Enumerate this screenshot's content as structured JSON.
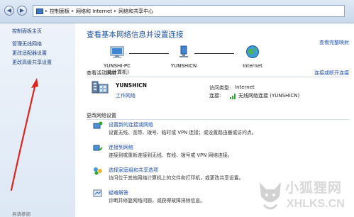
{
  "addressbar": {
    "crumbs": [
      "控制面板",
      "网络和 Internet",
      "网络和共享中心"
    ]
  },
  "sidebar": {
    "items": [
      {
        "label": "控制面板主页"
      },
      {
        "label": "管理无线网络"
      },
      {
        "label": "更改适配器设置"
      },
      {
        "label": "更改高级共享设置"
      }
    ],
    "see_also": "另请参阅"
  },
  "main": {
    "title": "查看基本网络信息并设置连接",
    "full_map": "查看完整映射",
    "map": {
      "pc_name": "YUNSHI-PC",
      "pc_sub": "(此计算机)",
      "network": "YUNSHICN",
      "internet": "Internet"
    },
    "active_header": "查看活动网络",
    "connect_disconnect": "连接或断开连接",
    "active": {
      "name": "YUNSHICN",
      "type": "工作网络",
      "access_label": "访问类型:",
      "access_value": "Internet",
      "conn_label": "连接:",
      "conn_value": "无线网络连接 (YUNSHICN)"
    },
    "change_header": "更改网络设置",
    "tasks": [
      {
        "link": "设置新的连接或网络",
        "desc": "设置无线、宽带、拨号、临时或 VPN 连接；或设置路由器或访问点。"
      },
      {
        "link": "连接到网络",
        "desc": "连接到或重新连接到无线、有线、拨号或 VPN 网络连接。"
      },
      {
        "link": "选择家庭组和共享选项",
        "desc": "访问位于其他网络计算机上的文件和打印机，或更改共享设置。"
      },
      {
        "link": "疑难解答",
        "desc": "诊断并修复网络问题，或获得故障排除信息。"
      }
    ]
  },
  "watermark": {
    "title": "小狐狸网",
    "url": "XHLKS.CN"
  },
  "colors": {
    "link": "#1c4fb0",
    "title": "#1a4fa0",
    "sidebar_top": "#eef3fa",
    "arrow": "#e0231c"
  }
}
